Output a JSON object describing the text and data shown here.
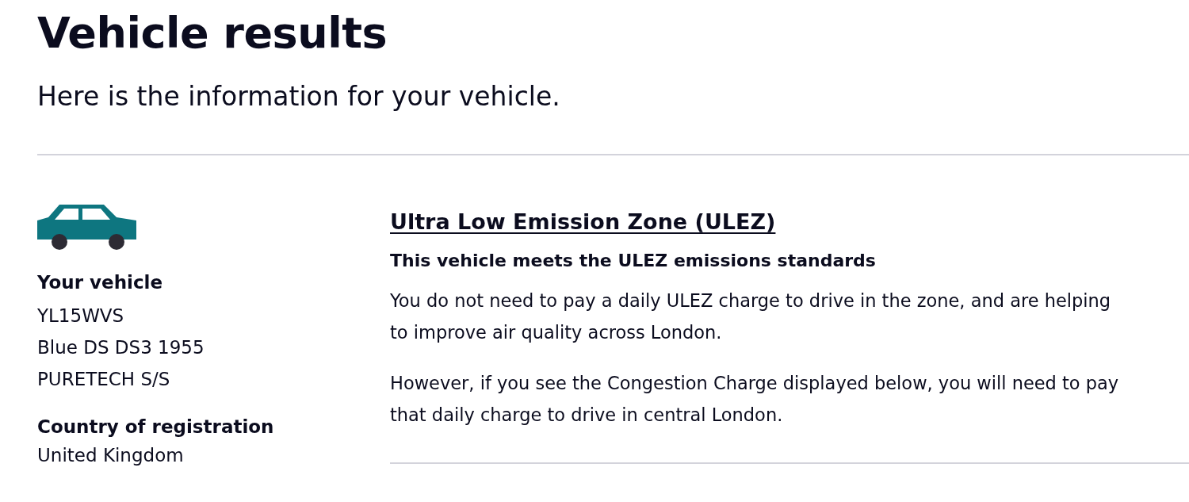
{
  "page": {
    "title": "Vehicle results",
    "subtitle": "Here is the information for your vehicle."
  },
  "vehicle": {
    "heading": "Your vehicle",
    "details": [
      "YL15WVS",
      "Blue DS DS3 1955",
      "PURETECH S/S"
    ],
    "country_heading": "Country of registration",
    "country": "United Kingdom"
  },
  "ulez": {
    "title": "Ultra Low Emission Zone (ULEZ)",
    "status": "This vehicle meets the ULEZ emissions standards",
    "paragraphs": [
      "You do not need to pay a daily ULEZ charge to drive in the zone, and are helping to improve air quality across London.",
      "However, if you see the Congestion Charge displayed below, you will need to pay that daily charge to drive in central London."
    ]
  }
}
